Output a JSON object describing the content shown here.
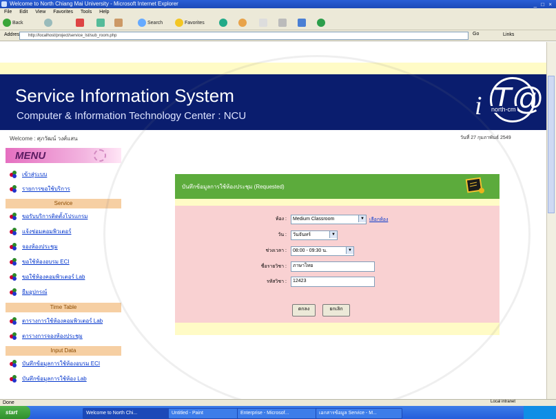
{
  "window": {
    "title": "Welcome to North Chiang Mai University - Microsoft Internet Explorer",
    "controls": "_ □ ×"
  },
  "menubar": [
    "File",
    "Edit",
    "View",
    "Favorites",
    "Tools",
    "Help"
  ],
  "toolbar": {
    "back": "Back",
    "search": "Search",
    "favorites": "Favorites"
  },
  "addressbar": {
    "label": "Address",
    "url": "http://localhost/project/service_lst/sub_room.php",
    "go": "Go",
    "links": "Links"
  },
  "banner": {
    "title": "Service Information System",
    "subtitle": "Computer & Information Technology Center : NCU",
    "logo_i": "i",
    "logo_at": "T@",
    "logo_tag": "north-cm"
  },
  "welcome": "Welcome : ศุภวัฒน์ วงศ์แสน",
  "date": "วันที่ 27 กุมภาพันธ์ 2549",
  "sidebar": {
    "menu_title": "MENU",
    "items_top": [
      {
        "label": "เข้าสู่ระบบ"
      },
      {
        "label": "รายการขอใช้บริการ"
      }
    ],
    "section_service": "Service",
    "items_service": [
      {
        "label": "ขอรับบริการติดตั้งโปรแกรม"
      },
      {
        "label": "แจ้งซ่อมคอมพิวเตอร์"
      },
      {
        "label": "จองห้องประชุม"
      },
      {
        "label": "ขอใช้ห้องอบรม ECI"
      },
      {
        "label": "ขอใช้ห้องคอมพิวเตอร์ Lab"
      },
      {
        "label": "ยืมอุปกรณ์"
      }
    ],
    "section_timetable": "Time Table",
    "items_timetable": [
      {
        "label": "ตารางการใช้ห้องคอมพิวเตอร์ Lab"
      },
      {
        "label": "ตารางการจองห้องประชุม"
      }
    ],
    "section_inputdata": "Input Data",
    "items_inputdata": [
      {
        "label": "บันทึกข้อมูลการใช้ห้องอบรม ECI"
      },
      {
        "label": "บันทึกข้อมูลการใช้ห้อง Lab"
      }
    ]
  },
  "panel": {
    "title": "บันทึกข้อมูลการใช้ห้องประชุม (Requested)",
    "fields": {
      "room_label": "ห้อง :",
      "room_value": "Medium Classroom",
      "room_link": "เลือกห้อง",
      "day_label": "วัน :",
      "day_value": "วันจันทร์",
      "time_label": "ช่วงเวลา :",
      "time_value": "08:00 - 09:30 น.",
      "subject_label": "ชื่อรายวิชา :",
      "subject_value": "ภาษาไทย",
      "code_label": "รหัสวิชา :",
      "code_value": "12423"
    },
    "buttons": {
      "submit": "ตกลง",
      "cancel": "ยกเลิก"
    }
  },
  "statusbar": {
    "left": "Done",
    "zone": "Local intranet"
  },
  "taskbar": {
    "start": "start",
    "tasks": [
      "Welcome to North Chi...",
      "Untitled - Paint",
      "Enterprise - Microsof...",
      "เอกสารข้อมูล Service - M..."
    ]
  },
  "colors": {
    "banner_bg": "#0a1d6e",
    "panel_header": "#5cab3c",
    "panel_body": "#f9d1d2",
    "menu_header": "#e56fc0",
    "section_bg": "#f6cfa3",
    "link": "#0033cc"
  }
}
